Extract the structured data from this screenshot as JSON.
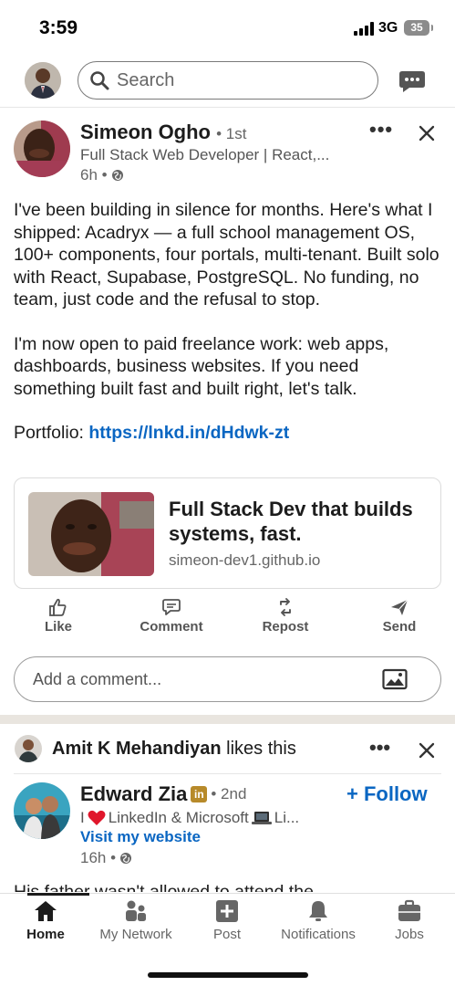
{
  "status_bar": {
    "time": "3:59",
    "network": "3G",
    "battery": "35"
  },
  "topnav": {
    "search_placeholder": "Search"
  },
  "post1": {
    "author_name": "Simeon Ogho",
    "degree": "• 1st",
    "headline": "Full Stack Web Developer | React,...",
    "time": "6h •",
    "body_p1": "I've been building in silence for months. Here's what I shipped: Acadryx — a full school management OS, 100+ components, four portals, multi-tenant. Built solo with React, Supabase, PostgreSQL. No funding, no team, just code and the refusal to stop.",
    "body_p2": "I'm now open to paid freelance work: web apps, dashboards, business websites. If you need something built fast and built right, let's talk.",
    "portfolio_label": "Portfolio:",
    "portfolio_link": "https://lnkd.in/dHdwk-zt",
    "link_card": {
      "title": "Full Stack Dev that builds systems, fast.",
      "domain": "simeon-dev1.github.io"
    },
    "actions": {
      "like": "Like",
      "comment": "Comment",
      "repost": "Repost",
      "send": "Send"
    },
    "comment_placeholder": "Add a comment..."
  },
  "post2": {
    "liker_name": "Amit K Mehandiyan",
    "liker_suffix": "likes this",
    "author_name": "Edward Zia",
    "badge": "in",
    "degree": "• 2nd",
    "follow_label": "+ Follow",
    "headline_prefix": "I",
    "headline_mid": "LinkedIn & Microsoft",
    "headline_suffix": "Li...",
    "visit_link": "Visit my website",
    "time": "16h •",
    "snippet": "His father wasn't allowed to attend the"
  },
  "tabbar": {
    "tabs": [
      "Home",
      "My Network",
      "Post",
      "Notifications",
      "Jobs"
    ],
    "active": "Home"
  },
  "colors": {
    "brand_blue": "#0a66c2",
    "text": "#1c1c1c",
    "muted": "#666666"
  }
}
